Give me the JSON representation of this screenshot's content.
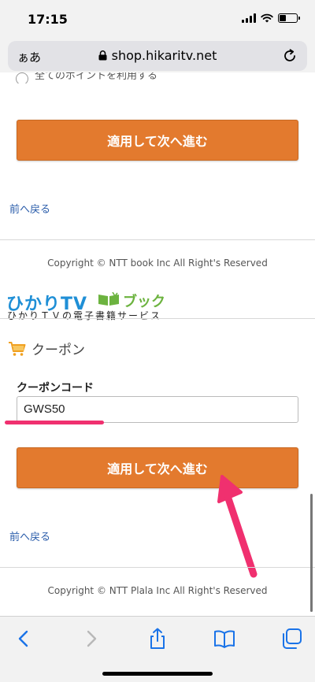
{
  "status_bar": {
    "time": "17:15"
  },
  "browser": {
    "text_size_label": "ぁあ",
    "url": "shop.hikaritv.net"
  },
  "section1": {
    "radio_label": "全てのポイントを利用する",
    "apply_button": "適用して次へ進む",
    "back_link": "前へ戻る",
    "copyright": "Copyright © NTT book Inc All Right's Reserved"
  },
  "logo": {
    "main": "ひかりTV",
    "buk": "ブック",
    "sub": "ひかりＴＶの電子書籍サービス"
  },
  "coupon": {
    "heading": "クーポン",
    "field_label": "クーポンコード",
    "code_value": "GWS50",
    "apply_button": "適用して次へ進む",
    "back_link": "前へ戻る"
  },
  "footer": {
    "copyright": "Copyright © NTT Plala Inc All Right's Reserved"
  },
  "colors": {
    "accent": "#e37a2e",
    "link": "#2a5caa",
    "annotation": "#f0306f",
    "logo_blue": "#1f8fd6",
    "logo_green": "#6cb33f"
  },
  "toolbar": {
    "icons": [
      "back-icon",
      "forward-icon",
      "share-icon",
      "bookmarks-icon",
      "tabs-icon"
    ]
  }
}
